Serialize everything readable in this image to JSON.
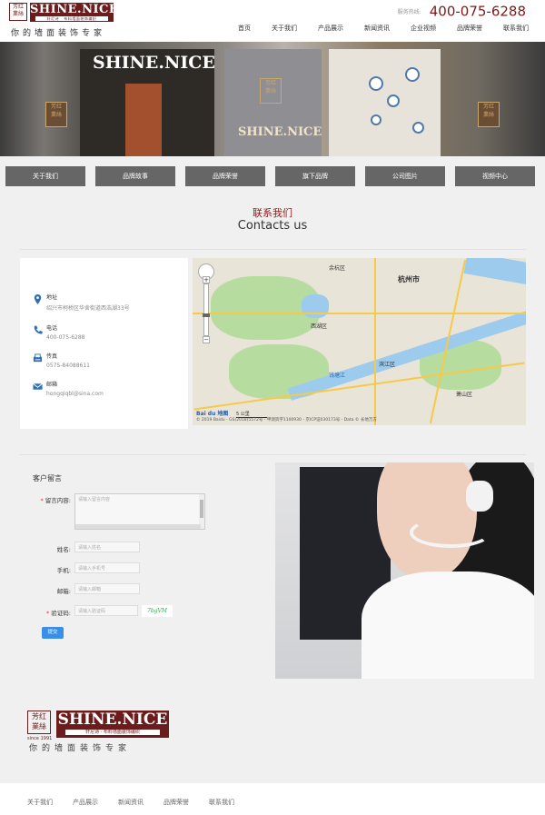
{
  "brand": {
    "seal": "芳红\n業絲",
    "name": "SHINE.NICE",
    "subtitle": "轩尼诗 · 布料墙面装饰编织",
    "slogan": "你的墙面装饰专家",
    "since": "since 1991"
  },
  "hotline": {
    "label": "服务热线:",
    "number": "400-075-6288"
  },
  "nav": [
    "首页",
    "关于我们",
    "产品展示",
    "新闻资讯",
    "企业视频",
    "品牌荣誉",
    "联系我们"
  ],
  "banner": {
    "sign_top": "SHINE.NICE",
    "sign_center": "SHINE.NICE"
  },
  "quick_links": [
    "关于我们",
    "品牌故事",
    "品牌荣誉",
    "旗下品牌",
    "公司图片",
    "视频中心"
  ],
  "section": {
    "title_cn": "联系我们",
    "title_en": "Contacts us"
  },
  "contact": {
    "address_label": "地址",
    "address_value": "绍兴市柯桥区华舍街道西浩湖33号",
    "phone_label": "电话",
    "phone_value": "400-075-6288",
    "fax_label": "传真",
    "fax_value": "0575-84088611",
    "email_label": "邮箱",
    "email_value": "hongqiqbl@sina.com"
  },
  "map": {
    "city": "杭州市",
    "places": [
      "西湖区",
      "滨江区",
      "萧山区",
      "余杭区",
      "钱塘江"
    ],
    "scale": "5 公里",
    "provider": "Bai du 地图",
    "copyright": "© 2019 Baidu - GS(2018)5572号 - 甲测资字1100930 - 京ICP证030173号 - Data © 长地万方"
  },
  "form": {
    "title": "客户留言",
    "message_label": "留言内容:",
    "message_placeholder": "请输入留言内容",
    "name_label": "姓名:",
    "name_placeholder": "请输入姓名",
    "phone_label": "手机:",
    "phone_placeholder": "请输入手机号",
    "email_label": "邮箱:",
    "email_placeholder": "请输入邮箱",
    "captcha_label": "验证码:",
    "captcha_placeholder": "请输入验证码",
    "captcha_code": "7bgVM",
    "submit_label": "提交"
  },
  "footer_nav": [
    "关于我们",
    "产品展示",
    "新闻资讯",
    "品牌荣誉",
    "联系我们"
  ],
  "colors": {
    "brand": "#6b1d1d",
    "title_red": "#8b1c1c",
    "button_gray": "#666666",
    "submit_blue": "#3a8ee6"
  }
}
